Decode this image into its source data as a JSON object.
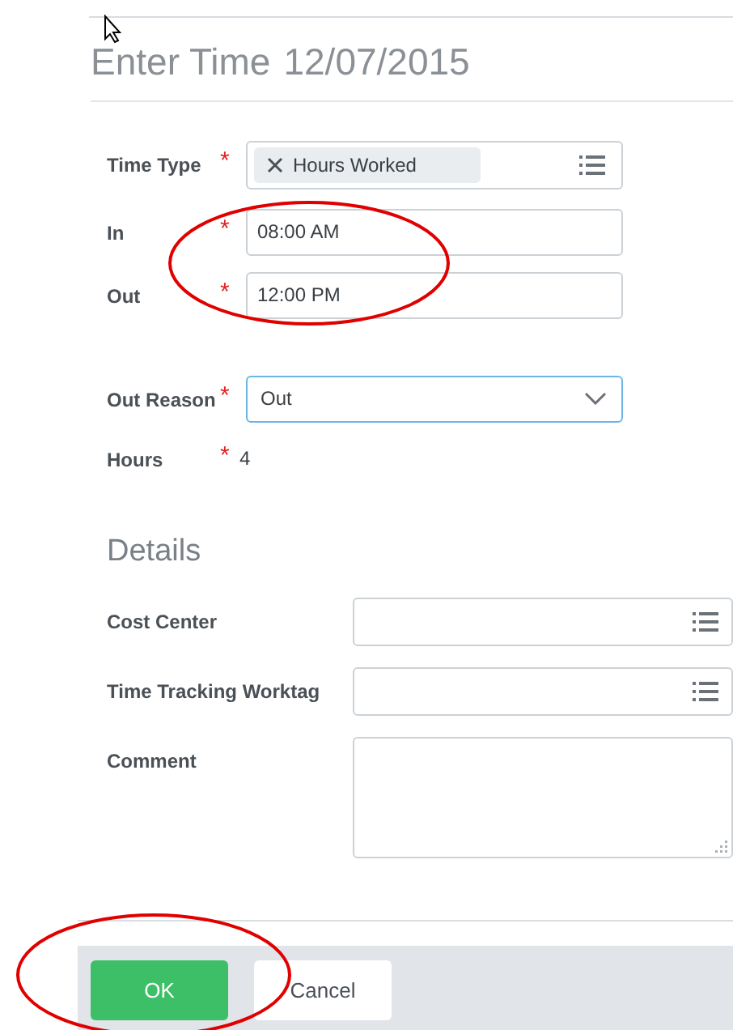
{
  "title": {
    "text": "Enter Time",
    "date": "12/07/2015"
  },
  "fields": [
    {
      "label": "Time Type",
      "required_mark": "*",
      "kind": "chip",
      "value": "Hours Worked"
    },
    {
      "label": "In",
      "required_mark": "*",
      "kind": "text",
      "value": "08:00 AM"
    },
    {
      "label": "Out",
      "required_mark": "*",
      "kind": "text",
      "value": "12:00 PM"
    },
    {
      "label": "Out Reason",
      "required_mark": "*",
      "kind": "select",
      "value": "Out",
      "focused": true
    },
    {
      "label": "Hours",
      "required_mark": "*",
      "kind": "readonly",
      "value": "4"
    }
  ],
  "details": {
    "heading": "Details",
    "fields": [
      {
        "label": "Cost Center",
        "kind": "prompt"
      },
      {
        "label": "Time Tracking Worktag",
        "kind": "prompt"
      },
      {
        "label": "Comment",
        "kind": "textarea"
      }
    ]
  },
  "buttons": [
    {
      "label": "OK",
      "kind": "primary"
    },
    {
      "label": "Cancel",
      "kind": "secondary"
    }
  ]
}
